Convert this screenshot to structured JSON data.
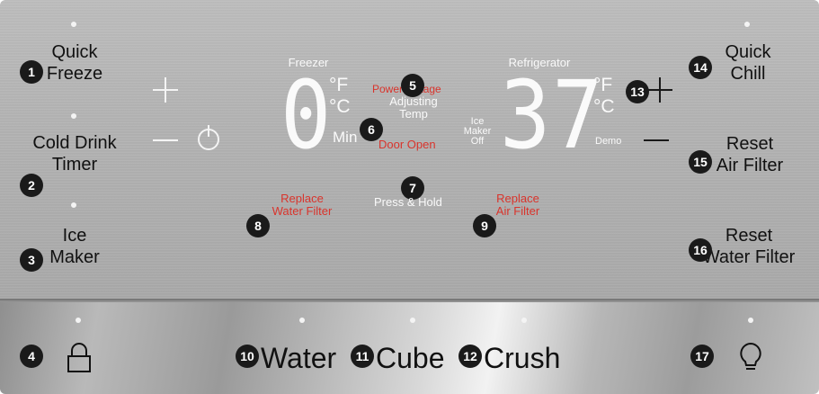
{
  "controls": {
    "quick_freeze": {
      "line1": "Quick",
      "line2": "Freeze",
      "marker": "1"
    },
    "cold_drink_timer": {
      "line1": "Cold Drink",
      "line2": "Timer",
      "marker": "2"
    },
    "ice_maker": {
      "line1": "Ice",
      "line2": "Maker",
      "marker": "3"
    },
    "lock": {
      "marker": "4"
    },
    "quick_chill": {
      "line1": "Quick",
      "line2": "Chill",
      "marker": "14"
    },
    "reset_air_filter": {
      "line1": "Reset",
      "line2": "Air Filter",
      "marker": "15"
    },
    "reset_water_filter": {
      "line1": "Reset",
      "line2": "Water Filter",
      "marker": "16"
    },
    "light": {
      "marker": "17"
    },
    "water": {
      "label": "Water",
      "marker": "10"
    },
    "cube": {
      "label": "Cube",
      "marker": "11"
    },
    "crush": {
      "label": "Crush",
      "marker": "12"
    }
  },
  "display": {
    "freezer": {
      "title": "Freezer",
      "temperature": "0",
      "unit_f": "°F",
      "unit_c": "°C",
      "min_label": "Min"
    },
    "refrigerator": {
      "title": "Refrigerator",
      "temperature": "37",
      "unit_f": "°F",
      "unit_c": "°C",
      "demo_label": "Demo"
    },
    "power_outage": "Power Outage",
    "adjusting_temp_line1": "Adjusting",
    "adjusting_temp_line2": "Temp",
    "door_open": "Door Open",
    "ice_maker_off_line1": "Ice",
    "ice_maker_off_line2": "Maker",
    "ice_maker_off_line3": "Off",
    "press_and_hold": "Press & Hold",
    "replace_water_filter_line1": "Replace",
    "replace_water_filter_line2": "Water Filter",
    "replace_air_filter_line1": "Replace",
    "replace_air_filter_line2": "Air Filter"
  },
  "markers": {
    "power_outage": "5",
    "door_open": "6",
    "press_and_hold": "7",
    "replace_water_filter": "8",
    "replace_air_filter": "9",
    "plus_right": "13"
  },
  "colors": {
    "alert_red": "#d9342c",
    "display_white": "#fafafa",
    "marker_black": "#1a1a1a"
  },
  "icons": {
    "plus_left": "plus-icon",
    "minus_left": "minus-icon",
    "timer": "timer-icon",
    "plus_right": "plus-icon",
    "minus_right": "minus-icon",
    "lock": "lock-icon",
    "light": "lightbulb-icon"
  }
}
